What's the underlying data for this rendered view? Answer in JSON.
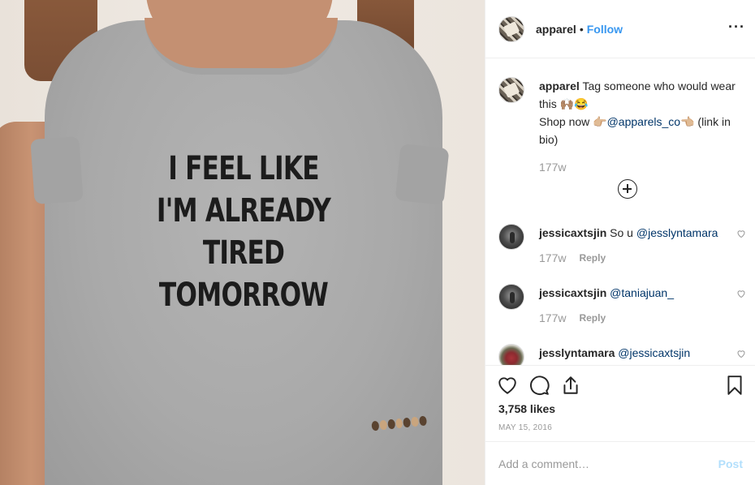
{
  "photo": {
    "slogan_lines": [
      "I FEEL LIKE",
      "I'M ALREADY",
      "TIRED TOMORROW"
    ]
  },
  "header": {
    "username": "apparel",
    "separator": "•",
    "follow_label": "Follow",
    "more_label": "···"
  },
  "caption": {
    "username": "apparel",
    "text_1": "Tag someone who would wear this 🙌🏽😂",
    "shop_prefix": "Shop now 👉🏼",
    "shop_mention": "@apparels_co",
    "shop_suffix": "👈🏼 (link in bio)",
    "time": "177w"
  },
  "comments": [
    {
      "username": "jessicaxtsjin",
      "text": "So u ",
      "mention": "@jesslyntamara",
      "time": "177w",
      "reply_label": "Reply"
    },
    {
      "username": "jessicaxtsjin",
      "text": "",
      "mention": "@taniajuan_",
      "time": "177w",
      "reply_label": "Reply"
    },
    {
      "username": "jesslyntamara",
      "text": "",
      "mention": "@jessicaxtsjin",
      "time": "",
      "reply_label": ""
    }
  ],
  "actions": {
    "likes": "3,758 likes",
    "date": "MAY 15, 2016"
  },
  "add_comment": {
    "placeholder": "Add a comment…",
    "post_label": "Post"
  },
  "colors": {
    "link_blue": "#3897f0",
    "mention_blue": "#003569",
    "muted": "#999999",
    "post_disabled": "#b2dffc"
  },
  "icons": {
    "like": "heart-icon",
    "comment": "comment-bubble-icon",
    "share": "share-icon",
    "save": "bookmark-icon",
    "load_more": "plus-circle-icon",
    "more": "ellipsis-icon"
  }
}
